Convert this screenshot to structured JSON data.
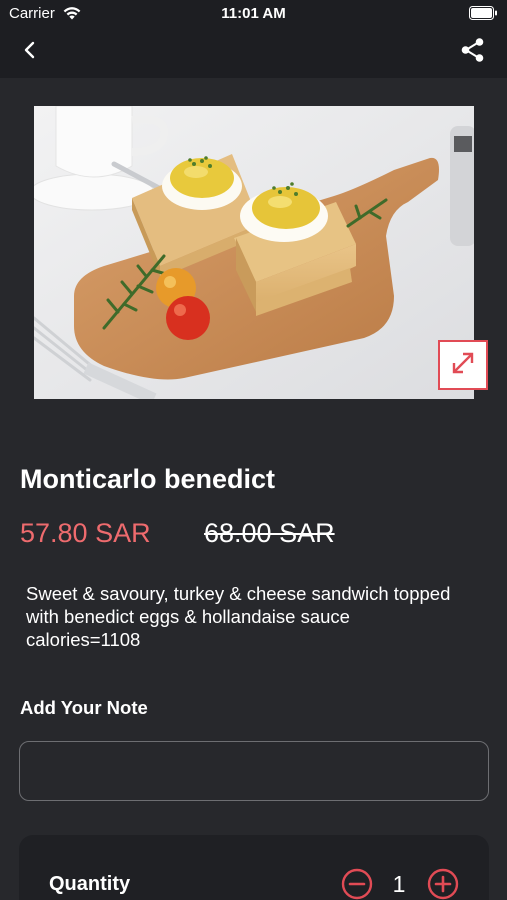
{
  "status_bar": {
    "carrier": "Carrier",
    "time": "11:01 AM"
  },
  "nav": {
    "back_icon": "chevron-left-icon",
    "share_icon": "share-icon"
  },
  "product": {
    "image_icon": "expand-arrows-icon",
    "name": "Monticarlo benedict",
    "price_discounted": "57.80 SAR",
    "price_original": "68.00 SAR",
    "description_lines": [
      "Sweet & savoury, turkey & cheese sandwich topped",
      "with benedict eggs & hollandaise sauce",
      "calories=1108"
    ]
  },
  "note": {
    "label": "Add Your Note",
    "value": "",
    "placeholder": ""
  },
  "quantity": {
    "label": "Quantity",
    "value": "1",
    "minus_icon": "minus-circle-icon",
    "plus_icon": "plus-circle-icon"
  },
  "colors": {
    "background": "#27282c",
    "header": "#1d1e22",
    "accent": "#e14b55",
    "price": "#ee6b6e"
  }
}
